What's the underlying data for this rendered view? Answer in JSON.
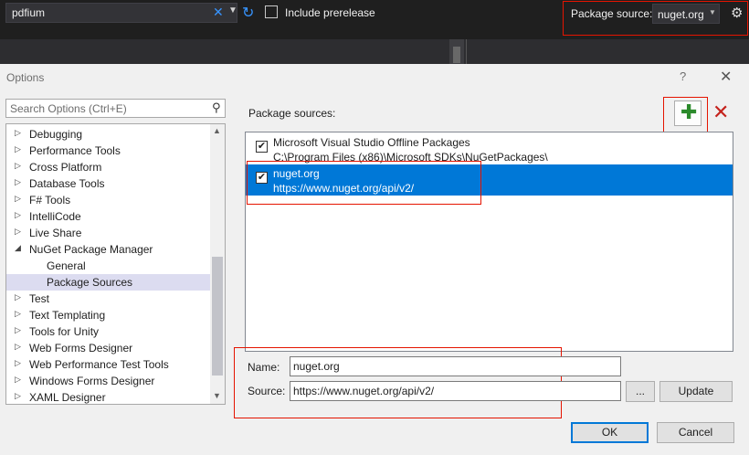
{
  "toolbar": {
    "search_value": "pdfium",
    "include_prerelease_label": "Include prerelease",
    "package_source_label": "Package source:",
    "package_source_value": "nuget.org"
  },
  "dialog": {
    "title": "Options",
    "help": "?",
    "close": "✕"
  },
  "left": {
    "search_placeholder": "Search Options (Ctrl+E)",
    "tree": [
      {
        "label": "Debugging",
        "expanded": false,
        "child": false
      },
      {
        "label": "Performance Tools",
        "expanded": false,
        "child": false
      },
      {
        "label": "Cross Platform",
        "expanded": false,
        "child": false
      },
      {
        "label": "Database Tools",
        "expanded": false,
        "child": false
      },
      {
        "label": "F# Tools",
        "expanded": false,
        "child": false
      },
      {
        "label": "IntelliCode",
        "expanded": false,
        "child": false
      },
      {
        "label": "Live Share",
        "expanded": false,
        "child": false
      },
      {
        "label": "NuGet Package Manager",
        "expanded": true,
        "child": false
      },
      {
        "label": "General",
        "child": true
      },
      {
        "label": "Package Sources",
        "child": true,
        "selected": true
      },
      {
        "label": "Test",
        "expanded": false,
        "child": false
      },
      {
        "label": "Text Templating",
        "expanded": false,
        "child": false
      },
      {
        "label": "Tools for Unity",
        "expanded": false,
        "child": false
      },
      {
        "label": "Web Forms Designer",
        "expanded": false,
        "child": false
      },
      {
        "label": "Web Performance Test Tools",
        "expanded": false,
        "child": false
      },
      {
        "label": "Windows Forms Designer",
        "expanded": false,
        "child": false
      },
      {
        "label": "XAML Designer",
        "expanded": false,
        "child": false
      }
    ]
  },
  "right": {
    "header": "Package sources:",
    "sources": [
      {
        "name": "Microsoft Visual Studio Offline Packages",
        "url": "C:\\Program Files (x86)\\Microsoft SDKs\\NuGetPackages\\",
        "checked": true,
        "selected": false
      },
      {
        "name": "nuget.org",
        "url": "https://www.nuget.org/api/v2/",
        "checked": true,
        "selected": true
      }
    ],
    "name_label": "Name:",
    "name_value": "nuget.org",
    "source_label": "Source:",
    "source_value": "https://www.nuget.org/api/v2/",
    "browse_label": "...",
    "update_label": "Update",
    "ok_label": "OK",
    "cancel_label": "Cancel"
  },
  "colors": {
    "highlight_red": "#e51400",
    "selection_blue": "#0078d7",
    "add_green": "#2b8a2b"
  }
}
